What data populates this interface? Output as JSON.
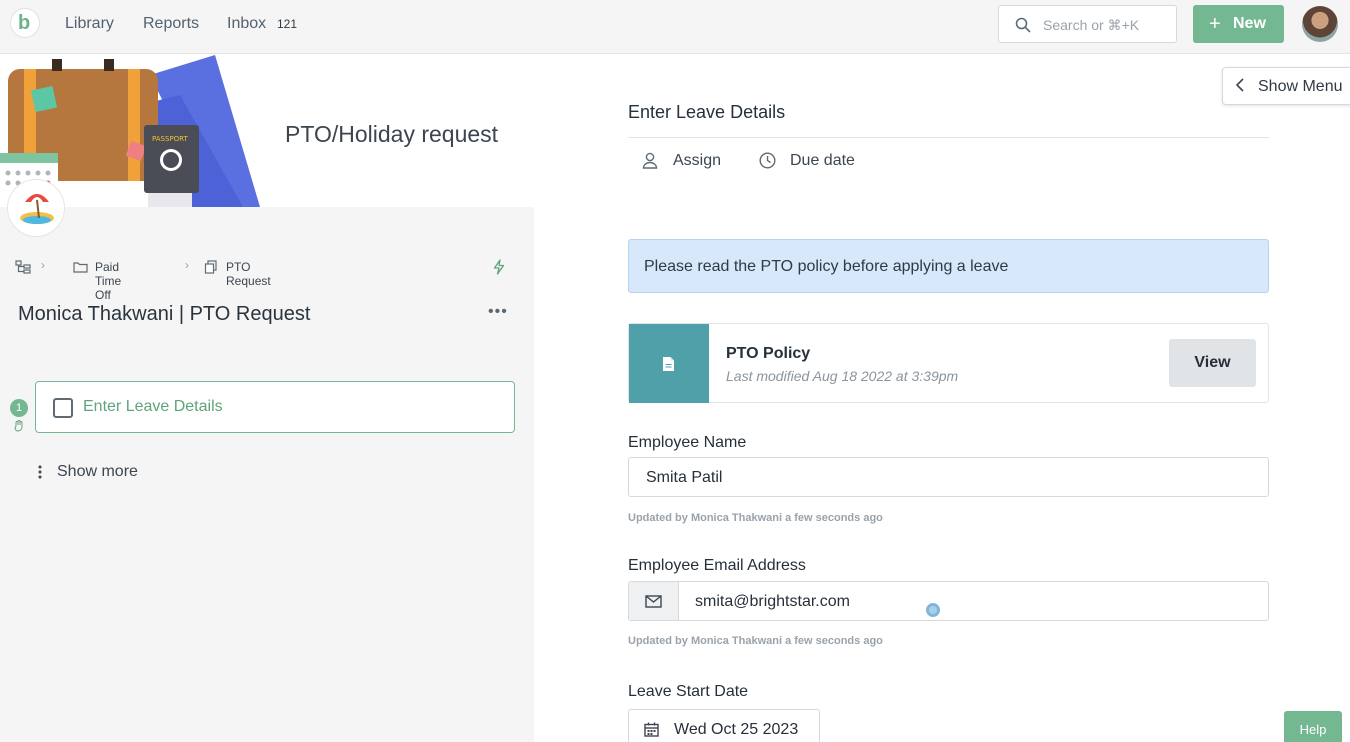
{
  "nav": {
    "library": "Library",
    "reports": "Reports",
    "inbox": "Inbox",
    "inbox_count": "121",
    "search_placeholder": "Search or ⌘+K",
    "new_label": "New"
  },
  "template": {
    "title": "PTO/Holiday request",
    "breadcrumb": [
      "Paid Time Off",
      "PTO Request"
    ],
    "run_title": "Monica Thakwani | PTO Request"
  },
  "tasks": [
    {
      "number": "1",
      "label": "Enter Leave Details"
    }
  ],
  "show_more": "Show more",
  "show_menu": "Show Menu",
  "form": {
    "section_title": "Enter Leave Details",
    "assign": "Assign",
    "due_date": "Due date",
    "banner": "Please read the PTO policy before applying a leave",
    "file": {
      "name": "PTO Policy",
      "modified": "Last modified Aug 18 2022 at 3:39pm",
      "view": "View"
    },
    "employee_name_label": "Employee Name",
    "employee_name_value": "Smita Patil",
    "employee_name_updated": "Updated by Monica Thakwani a few seconds ago",
    "email_label": "Employee Email Address",
    "email_value": "smita@brightstar.com",
    "email_updated": "Updated by Monica Thakwani a few seconds ago",
    "start_date_label": "Leave Start Date",
    "start_date_value": "Wed Oct 25 2023"
  },
  "help": "Help",
  "colors": {
    "brand_green": "#74b892",
    "banner_blue": "#d7e8fb",
    "file_teal": "#4fa0a8"
  }
}
